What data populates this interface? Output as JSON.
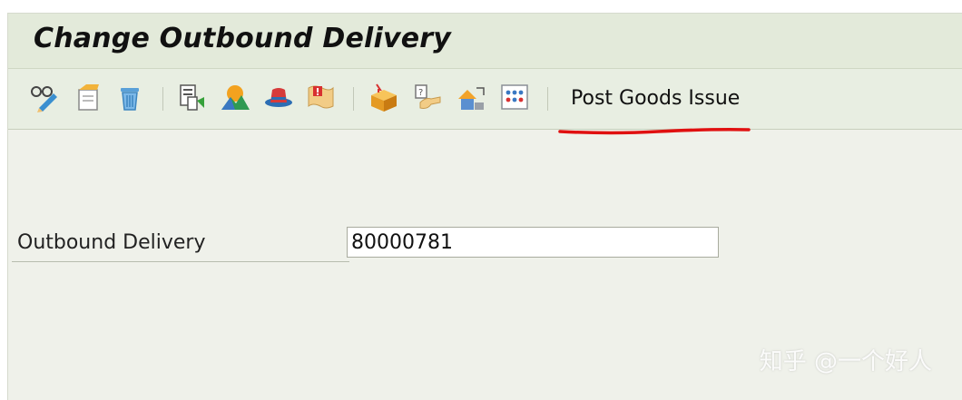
{
  "window": {
    "title": "Change Outbound Delivery"
  },
  "toolbar": {
    "icons": [
      "display-change-icon",
      "create-from-template-icon",
      "delete-trash-icon",
      "document-copy-icon",
      "mountain-overview-icon",
      "hat-partner-icon",
      "message-output-icon",
      "package-icon",
      "help-hand-icon",
      "house-flow-icon",
      "grid-dots-icon"
    ],
    "post_goods_issue_label": "Post Goods Issue"
  },
  "form": {
    "outbound_delivery_label": "Outbound Delivery",
    "outbound_delivery_value": "80000781"
  },
  "watermark": {
    "text": "知乎 @一个好人"
  },
  "colors": {
    "title_bg": "#e3eada",
    "toolbar_bg": "#e8eee2",
    "body_bg": "#eff1ea",
    "annotation_red": "#e01010"
  }
}
